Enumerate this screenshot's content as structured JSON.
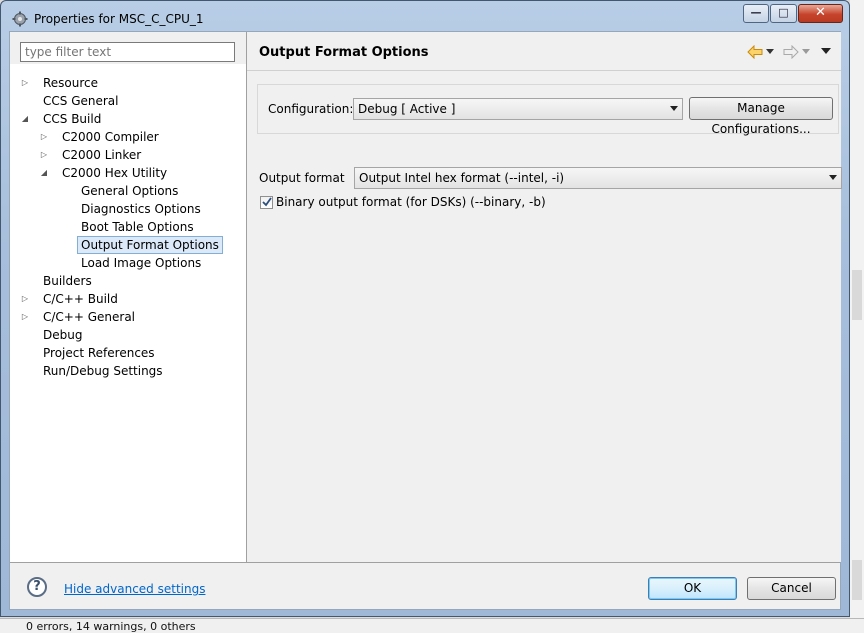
{
  "window": {
    "title": "Properties for MSC_C_CPU_1",
    "minimize_glyph": "—",
    "maximize_glyph": "□",
    "close_glyph": "✕"
  },
  "sidebar": {
    "filter_placeholder": "type filter text",
    "items": [
      {
        "label": "Resource",
        "expander": "collapsed"
      },
      {
        "label": "CCS General",
        "expander": "none"
      },
      {
        "label": "CCS Build",
        "expander": "expanded"
      },
      {
        "label": "C2000 Compiler",
        "expander": "collapsed"
      },
      {
        "label": "C2000 Linker",
        "expander": "collapsed"
      },
      {
        "label": "C2000 Hex Utility",
        "expander": "expanded"
      },
      {
        "label": "General Options",
        "expander": "none"
      },
      {
        "label": "Diagnostics Options",
        "expander": "none"
      },
      {
        "label": "Boot Table Options",
        "expander": "none"
      },
      {
        "label": "Output Format Options",
        "expander": "none",
        "selected": true
      },
      {
        "label": "Load Image Options",
        "expander": "none"
      },
      {
        "label": "Builders",
        "expander": "none"
      },
      {
        "label": "C/C++ Build",
        "expander": "collapsed"
      },
      {
        "label": "C/C++ General",
        "expander": "collapsed"
      },
      {
        "label": "Debug",
        "expander": "none"
      },
      {
        "label": "Project References",
        "expander": "none"
      },
      {
        "label": "Run/Debug Settings",
        "expander": "none"
      }
    ]
  },
  "main": {
    "heading": "Output Format Options",
    "nav_icons": [
      "back-arrow-icon",
      "back-dropdown-icon",
      "forward-arrow-icon",
      "forward-dropdown-icon",
      "view-menu-icon"
    ],
    "configuration": {
      "label": "Configuration:",
      "value": "Debug  [ Active ]",
      "manage_button": "Manage Configurations..."
    },
    "output_format": {
      "label": "Output format",
      "value": "Output Intel hex format (--intel, -i)"
    },
    "binary_output": {
      "label": "Binary output format (for DSKs) (--binary, -b)",
      "checked": true
    }
  },
  "footer": {
    "help_glyph": "?",
    "advanced_link": "Hide advanced settings",
    "ok_button": "OK",
    "cancel_button": "Cancel"
  },
  "background": {
    "status_text": "0 errors, 14 warnings, 0 others"
  },
  "colors": {
    "selection_bg": "#dbe9f8",
    "selection_border": "#85aed6",
    "link": "#0066cc",
    "accent_arrow": "#e8a317"
  }
}
